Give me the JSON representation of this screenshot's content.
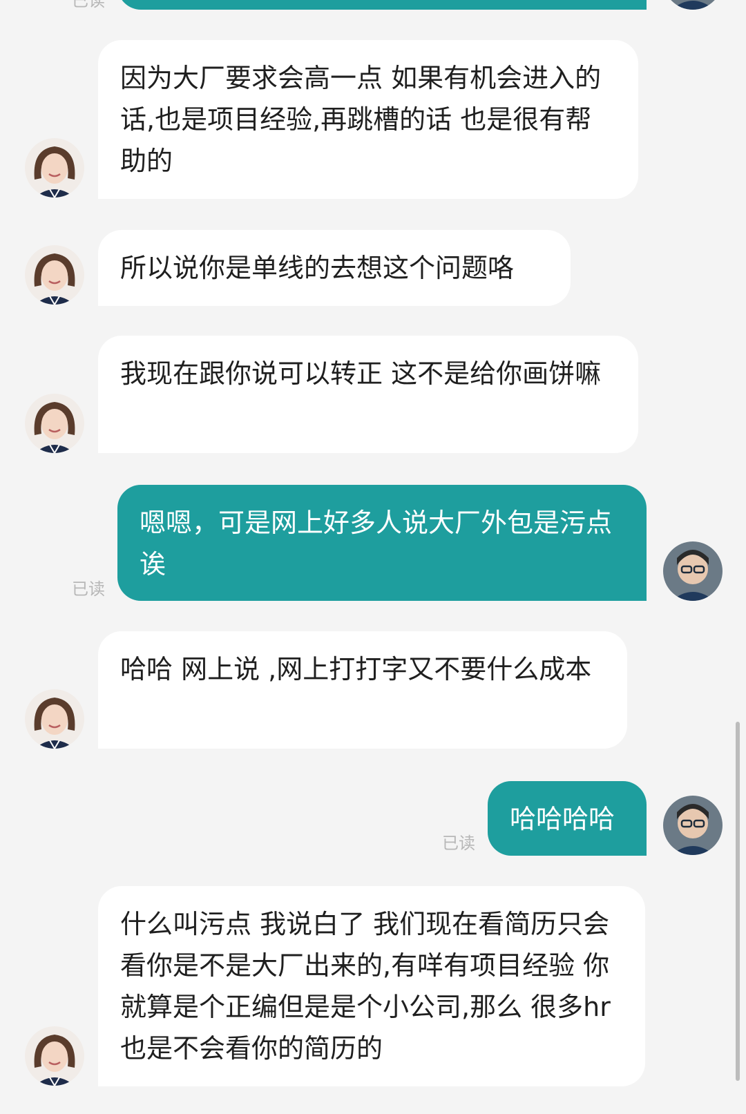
{
  "chat": {
    "colors": {
      "background": "#f4f4f4",
      "incoming_bubble": "#ffffff",
      "outgoing_bubble": "#1e9e9e",
      "read_label": "#b7b7b7"
    },
    "messages": [
      {
        "side": "out",
        "text": "",
        "read": "已读",
        "partial": true
      },
      {
        "side": "in",
        "text": "因为大厂要求会高一点 如果有机会进入的话,也是项目经验,再跳槽的话 也是很有帮助的"
      },
      {
        "side": "in",
        "text": "所以说你是单线的去想这个问题咯"
      },
      {
        "side": "in",
        "text": "我现在跟你说可以转正 这不是给你画饼嘛"
      },
      {
        "side": "out",
        "text": "嗯嗯，可是网上好多人说大厂外包是污点诶",
        "read": "已读"
      },
      {
        "side": "in",
        "text": "哈哈 网上说 ,网上打打字又不要什么成本"
      },
      {
        "side": "out",
        "text": "哈哈哈哈",
        "read": "已读"
      },
      {
        "side": "in",
        "text": "什么叫污点 我说白了 我们现在看简历只会看你是不是大厂出来的,有咩有项目经验 你就算是个正编但是是个小公司,那么 很多hr也是不会看你的简历的"
      }
    ]
  }
}
